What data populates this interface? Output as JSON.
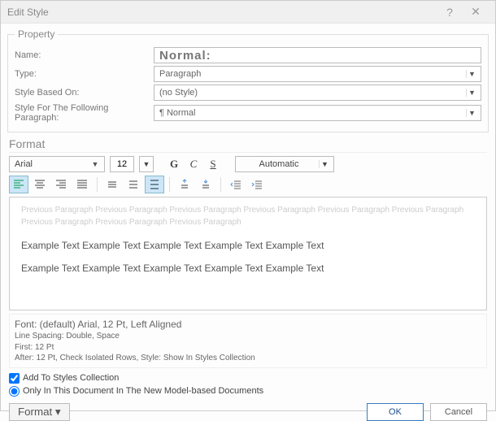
{
  "title": "Edit Style",
  "property": {
    "legend": "Property",
    "name_label": "Name:",
    "name_value": "Normal:",
    "type_label": "Type:",
    "type_value": "Paragraph",
    "based_label": "Style Based On:",
    "based_value": "(no Style)",
    "following_label": "Style For The Following Paragraph:",
    "following_value": "¶ Normal"
  },
  "format": {
    "heading": "Format",
    "font_name": "Arial",
    "font_size": "12",
    "bold": "G",
    "italic": "C",
    "underline": "S",
    "color": "Automatic"
  },
  "preview": {
    "ghost1": "Previous Paragraph Previous Paragraph Previous Paragraph Previous Paragraph Previous Paragraph Previous Paragraph",
    "ghost2": "Previous Paragraph Previous Paragraph Previous Paragraph",
    "example1": "Example Text Example Text Example Text Example Text Example Text",
    "example2": "Example Text Example Text Example Text Example Text Example Text"
  },
  "description": {
    "line1": "Font: (default) Arial, 12 Pt, Left Aligned",
    "line2": "Line Spacing: Double, Space",
    "line3": "First: 12 Pt",
    "line4": "After: 12 Pt, Check Isolated Rows, Style: Show In Styles Collection"
  },
  "checks": {
    "add_to_collection": "Add To Styles Collection",
    "only_in_doc": "Only In This Document In The New Model-based Documents"
  },
  "footer": {
    "format": "Format ▾",
    "ok": "OK",
    "cancel": "Cancel"
  }
}
